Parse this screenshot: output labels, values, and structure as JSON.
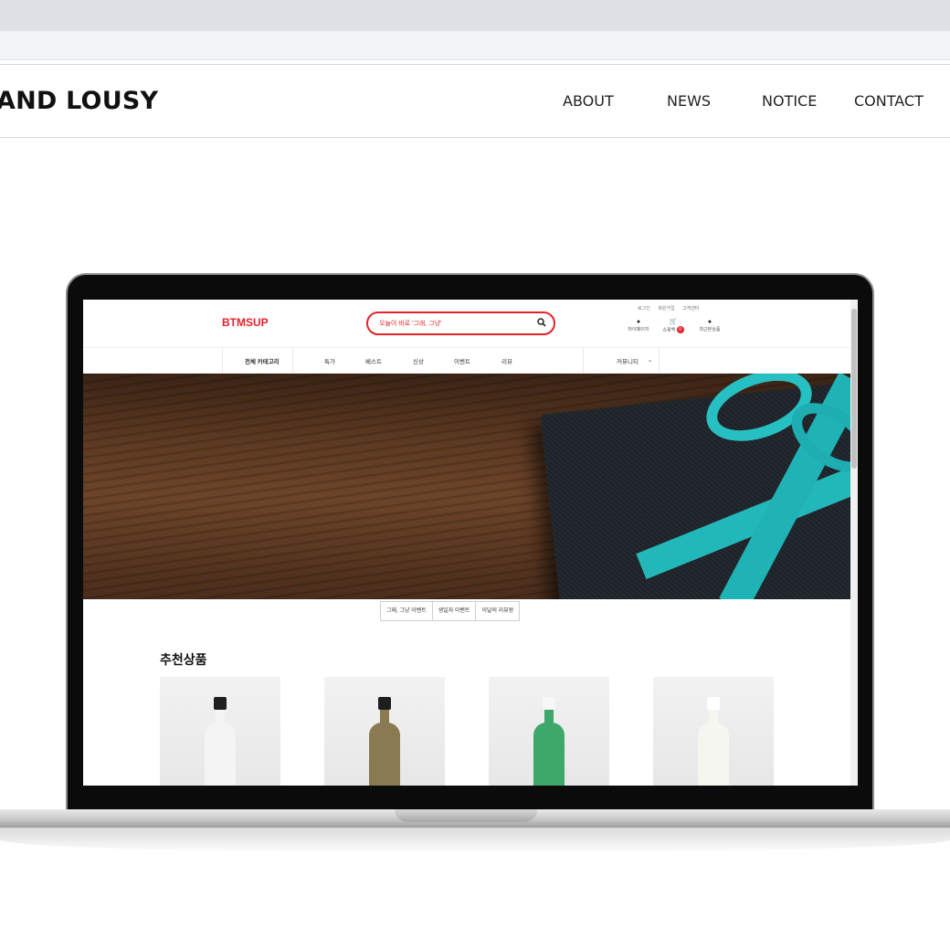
{
  "site": {
    "logo": "AND LOUSY",
    "nav": [
      "ABOUT",
      "NEWS",
      "NOTICE",
      "CONTACT"
    ]
  },
  "shop": {
    "logo": "BTMSUP",
    "search_placeholder": "오늘이 바로 '그래, 그냥'",
    "util_links": [
      "로그인",
      "회원가입",
      "고객센터"
    ],
    "util_icons": [
      {
        "icon": "user-icon",
        "label": "마이페이지"
      },
      {
        "icon": "cart-icon",
        "label": "쇼핑백",
        "badge": "0"
      },
      {
        "icon": "recent-icon",
        "label": "최근본상품"
      }
    ],
    "nav": [
      "전체 카테고리",
      "특가",
      "베스트",
      "신상",
      "이벤트",
      "리뷰",
      "커뮤니티"
    ],
    "nav_dropdown_glyph": "⌄",
    "tabs": [
      "그래, 그냥 이벤트",
      "생일자 이벤트",
      "이달의 리뷰왕"
    ],
    "section_title": "추천상품",
    "products": [
      {
        "name": "bottle-white",
        "cap": "#1e1e1e",
        "liquid": "#f4f4f4"
      },
      {
        "name": "bottle-gold",
        "cap": "#1e1e1e",
        "liquid": "#8a7a52"
      },
      {
        "name": "bottle-green",
        "cap": "#f7f7f7",
        "liquid": "#3ea86a"
      },
      {
        "name": "bottle-milk",
        "cap": "#ffffff",
        "liquid": "#f6f6f0"
      }
    ]
  },
  "colors": {
    "brand": "#e5222a",
    "ribbon": "#1fb3b6"
  }
}
